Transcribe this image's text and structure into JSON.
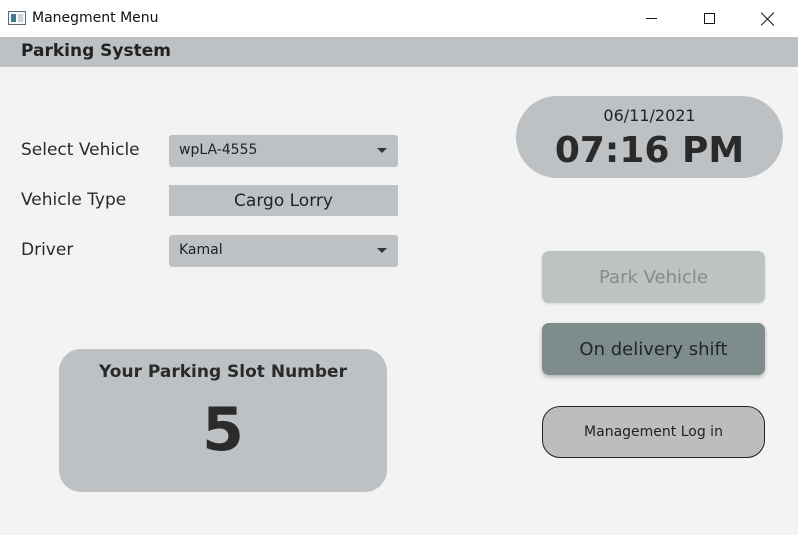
{
  "window": {
    "title": "Manegment Menu",
    "controls": [
      "minimize",
      "maximize",
      "close"
    ]
  },
  "menubar": {
    "title": "Parking System"
  },
  "form": {
    "vehicle_label": "Select Vehicle",
    "vehicle_value": "wpLA-4555",
    "type_label": "Vehicle Type",
    "type_value": "Cargo Lorry",
    "driver_label": "Driver",
    "driver_value": "Kamal"
  },
  "clock": {
    "date": "06/11/2021",
    "time": "07:16 PM"
  },
  "actions": {
    "park_label": "Park Vehicle",
    "park_enabled": false,
    "delivery_label": "On delivery shift",
    "login_label": "Management Log in"
  },
  "slot": {
    "title": "Your Parking Slot Number",
    "number": "5"
  },
  "colors": {
    "panel": "#bdc1c4",
    "delivery_button": "#7f8c8c",
    "background": "#f3f3f3"
  },
  "icons": [
    "app-window-icon",
    "minimize-icon",
    "maximize-icon",
    "close-icon",
    "dropdown-arrow-icon"
  ]
}
